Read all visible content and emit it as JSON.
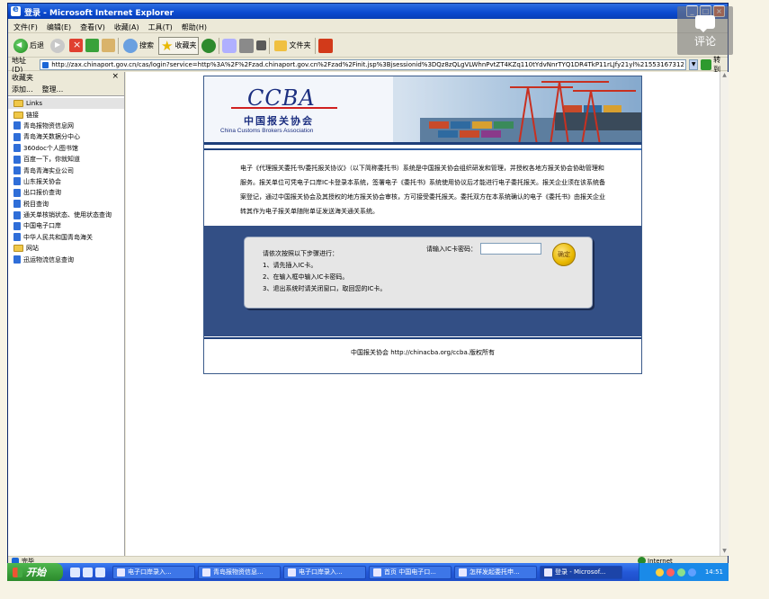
{
  "window": {
    "title": "登录 - Microsoft Internet Explorer"
  },
  "menu": [
    "文件(F)",
    "编辑(E)",
    "查看(V)",
    "收藏(A)",
    "工具(T)",
    "帮助(H)"
  ],
  "toolbar": {
    "back": "后退",
    "search": "搜索",
    "favorites": "收藏夹",
    "folder": "文件夹"
  },
  "address": {
    "label": "地址(D)",
    "url": "http://zax.chinaport.gov.cn/cas/login?service=http%3A%2F%2Fzad.chinaport.gov.cn%2Fzad%2Finit.jsp%3Bjsessionid%3DQz8zQLgVLWhnPvtZT4KZq110tYdvNnrTYQ1DR4TkP11rLJfy21yl%21553167312",
    "go": "转到"
  },
  "favorites": {
    "title": "收藏夹",
    "close": "×",
    "add": "添加...",
    "organize": "整理...",
    "items": [
      {
        "label": "Links",
        "type": "folder"
      },
      {
        "label": "链接",
        "type": "folder"
      },
      {
        "label": "青岛报物资信息网",
        "type": "page"
      },
      {
        "label": "青岛海关数据分中心",
        "type": "page"
      },
      {
        "label": "360doc个人图书馆",
        "type": "page"
      },
      {
        "label": "百度一下，你就知道",
        "type": "page"
      },
      {
        "label": "青岛青海实业公司",
        "type": "page"
      },
      {
        "label": "山东报关协会",
        "type": "page"
      },
      {
        "label": "出口报价查询",
        "type": "page"
      },
      {
        "label": "税目查询",
        "type": "page"
      },
      {
        "label": "通关单核销状态、使用状态查询",
        "type": "page"
      },
      {
        "label": "中国电子口岸",
        "type": "page"
      },
      {
        "label": "中华人民共和国青岛海关",
        "type": "page"
      },
      {
        "label": "网站",
        "type": "folder"
      },
      {
        "label": "迅运物流信息查询",
        "type": "page"
      }
    ]
  },
  "page": {
    "logo_mark": "CCBA",
    "logo_cn": "中国报关协会",
    "logo_en": "China Customs Brokers Association",
    "intro": "电子《代理报关委托书/委托报关协议》（以下简称委托书）系统是中国报关协会组织研发和管理，并授权各地方报关协会协助管理和服务。报关单位可凭电子口岸IC卡登录本系统，签署电子《委托书》系统使用协议后才能进行电子委托报关。报关企业须在该系统备案登记，通过中国报关协会及其授权的地方报关协会审核，方可接受委托报关。委托双方在本系统确认的电子《委托书》由报关企业转其作为电子报关单随附单证发送海关通关系统。",
    "steps_title": "请依次按照以下步骤进行：",
    "steps": [
      "1、请先插入IC卡。",
      "2、在输入框中输入IC卡密码。",
      "3、退出系统时请关闭窗口，取回您的IC卡。"
    ],
    "card_label": "请输入IC卡密码：",
    "ok": "确定",
    "footer": "中国报关协会 http://chinacba.org/ccba.版权所有"
  },
  "status": {
    "text": "完毕",
    "zone": "Internet"
  },
  "taskbar": {
    "start": "开始",
    "tasks": [
      {
        "label": "电子口岸录入...",
        "active": false
      },
      {
        "label": "青岛报物资信息...",
        "active": false
      },
      {
        "label": "电子口岸录入...",
        "active": false
      },
      {
        "label": "首页 中国电子口...",
        "active": false
      },
      {
        "label": "怎样发起委托申...",
        "active": false
      },
      {
        "label": "登录 - Microsof...",
        "active": true
      }
    ],
    "clock": "14:51"
  },
  "overlay": {
    "comment": "评论"
  }
}
